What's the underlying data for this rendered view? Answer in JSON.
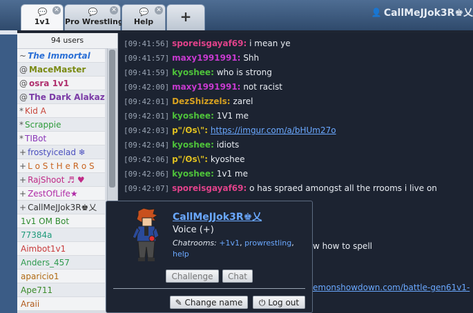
{
  "tabs": [
    {
      "label": "1v1",
      "active": true
    },
    {
      "label": "Pro Wrestling",
      "active": false
    },
    {
      "label": "Help",
      "active": false
    }
  ],
  "new_tab_glyph": "+",
  "current_user": "CallMeJJok3R♚乂",
  "userlist": {
    "count_label": "94 users",
    "users": [
      {
        "rank": "~",
        "name": "The Immortal",
        "color": "#2a6fd6",
        "italic": true
      },
      {
        "rank": "@",
        "name": "MaceMaster",
        "color": "#7a8a12"
      },
      {
        "rank": "@",
        "name": "osra 1v1",
        "color": "#b0306e"
      },
      {
        "rank": "@",
        "name": "The Dark Alakazam",
        "color": "#7b3aa6"
      },
      {
        "rank": "*",
        "name": "Kid A",
        "color": "#c8463a"
      },
      {
        "rank": "*",
        "name": "Scrappie",
        "color": "#2e9b3a"
      },
      {
        "rank": "*",
        "name": "TIBot",
        "color": "#8a36b8"
      },
      {
        "rank": "+",
        "name": "frostyicelad ❄",
        "color": "#4a4fbf"
      },
      {
        "rank": "+",
        "name": "L o S t H e R o S",
        "color": "#c86420"
      },
      {
        "rank": "+",
        "name": "RajShoot ♬ ♥",
        "color": "#c02a86"
      },
      {
        "rank": "+",
        "name": "ZestOfLife★",
        "color": "#b02aa6"
      },
      {
        "rank": "+",
        "name": "CallMeJJok3R♚乂",
        "color": "#333333"
      },
      {
        "rank": "",
        "name": "1v1 OM Bot",
        "color": "#2e8a2e"
      },
      {
        "rank": "",
        "name": "77384a",
        "color": "#1e9a7a"
      },
      {
        "rank": "",
        "name": "Aimbot1v1",
        "color": "#c83a3a"
      },
      {
        "rank": "",
        "name": "Anders_457",
        "color": "#2e9a4e"
      },
      {
        "rank": "",
        "name": "aparicio1",
        "color": "#b06a12"
      },
      {
        "rank": "",
        "name": "Ape711",
        "color": "#3a8a2a"
      },
      {
        "rank": "",
        "name": "Araii",
        "color": "#b05a1a"
      }
    ]
  },
  "chat": [
    {
      "time": "[09:41:56]",
      "user": "sporeisgayaf69:",
      "color": "#e0428a",
      "text": "i mean ye"
    },
    {
      "time": "[09:41:57]",
      "user": "maxy1991991:",
      "color": "#c83ad0",
      "text": "Shh"
    },
    {
      "time": "[09:41:59]",
      "user": "kyoshee:",
      "color": "#4ec23a",
      "text": "who is strong"
    },
    {
      "time": "[09:42:00]",
      "user": "maxy1991991:",
      "color": "#c83ad0",
      "text": "not racist"
    },
    {
      "time": "[09:42:01]",
      "user": "DezShizzels:",
      "color": "#d6a020",
      "text": "zarel"
    },
    {
      "time": "[09:42:01]",
      "user": "kyoshee:",
      "color": "#4ec23a",
      "text": "1V1 me"
    },
    {
      "time": "[09:42:03]",
      "user": "p\"/ʘs\\\":",
      "color": "#e0c020",
      "text": "",
      "link": "https://imgur.com/a/bHUm27o"
    },
    {
      "time": "[09:42:04]",
      "user": "kyoshee:",
      "color": "#4ec23a",
      "text": "idiots"
    },
    {
      "time": "[09:42:06]",
      "user": "p\"/ʘs\\\":",
      "color": "#e0c020",
      "text": "kyoshee"
    },
    {
      "time": "[09:42:06]",
      "user": "kyoshee:",
      "color": "#4ec23a",
      "text": "1v1 me"
    },
    {
      "time": "[09:42:07]",
      "user": "sporeisgayaf69:",
      "color": "#e0428a",
      "text": "o has spraed amongst all the rrooms i live on"
    },
    {
      "time": "",
      "user": "",
      "color": "#e0c020",
      "text": "w how to spell"
    },
    {
      "time": "",
      "user": "",
      "color": "#e0c020",
      "text": "",
      "link": "emonshowdown.com/battle-gen61v1-"
    }
  ],
  "popup": {
    "name": "CallMeJJok3R♚乂",
    "rank": "Voice (+)",
    "chatrooms_label": "Chatrooms:",
    "rooms": [
      "+1v1",
      "prowrestling",
      "help"
    ],
    "challenge_label": "Challenge",
    "chat_label": "Chat",
    "change_name_label": "Change name",
    "logout_label": "Log out"
  }
}
